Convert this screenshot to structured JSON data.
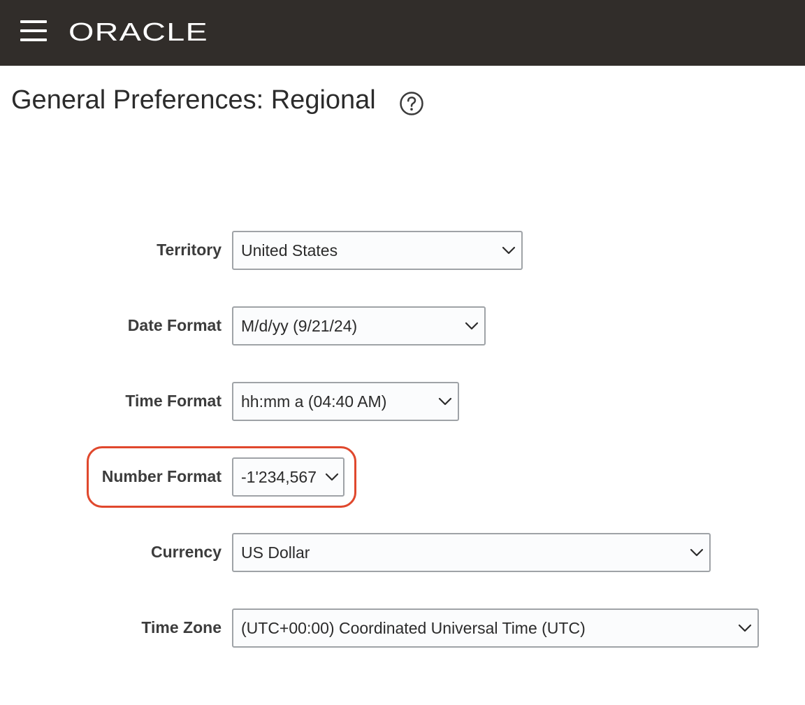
{
  "header": {
    "menu_icon": "hamburger-menu-icon",
    "brand": "ORACLE",
    "colors": {
      "background": "#312d2a",
      "foreground": "#ffffff"
    }
  },
  "page": {
    "title": "General Preferences: Regional",
    "help_icon": "question-circle-icon"
  },
  "form": {
    "territory": {
      "label": "Territory",
      "value": "United States"
    },
    "date_format": {
      "label": "Date Format",
      "value": "M/d/yy (9/21/24)"
    },
    "time_format": {
      "label": "Time Format",
      "value": "hh:mm a (04:40 AM)"
    },
    "number_format": {
      "label": "Number Format",
      "value": "-1'234,567"
    },
    "currency": {
      "label": "Currency",
      "value": "US Dollar"
    },
    "time_zone": {
      "label": "Time Zone",
      "value": "(UTC+00:00) Coordinated Universal Time (UTC)"
    }
  },
  "highlight": {
    "target": "number_format",
    "color": "#e0482d"
  }
}
